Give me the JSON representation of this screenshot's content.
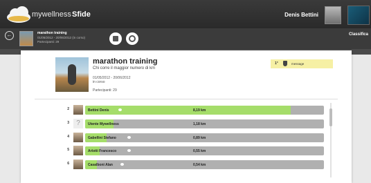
{
  "header": {
    "brand": "mywellness",
    "nav_tab": "Sfide",
    "user_name": "Denis Bettini"
  },
  "challenge_strip": {
    "title": "marathon training",
    "dates": "01/05/2012 - 20/06/2012 (in corso)",
    "participants": "Partecipanti: 29",
    "classifica_label": "Classifica"
  },
  "challenge": {
    "title": "marathon training",
    "subtitle": "Chi corre il maggior numero di km",
    "dates": "01/05/2012 - 20/06/2012",
    "status": "in corso",
    "participants": "Partecipanti: 29"
  },
  "my_rank": {
    "position": "1°",
    "message_label": "message"
  },
  "leaderboard": {
    "rows": [
      {
        "rank": "2",
        "name": "Bettini Denis",
        "distance": "8,19 km",
        "progress": 0.86,
        "has_photo": true
      },
      {
        "rank": "3",
        "name": "Utente Mywellness",
        "distance": "1,18 km",
        "progress": 0.12,
        "has_photo": false
      },
      {
        "rank": "4",
        "name": "Gabellini Stefano",
        "distance": "0,89 km",
        "progress": 0.09,
        "has_photo": true
      },
      {
        "rank": "5",
        "name": "Arlotti Francesco",
        "distance": "0,55 km",
        "progress": 0.06,
        "has_photo": true
      },
      {
        "rank": "6",
        "name": "Casalboni Alan",
        "distance": "0,54 km",
        "progress": 0.05,
        "has_photo": true
      }
    ]
  },
  "colors": {
    "progress_fill": "#a5dd6a",
    "bar_track": "#b0b0b0",
    "rank_highlight": "#f6f0a4",
    "topbar": "#2f2f2f"
  },
  "icons": [
    "cloud-logo-icon",
    "back-arrow-icon",
    "stop-icon",
    "refresh-icon",
    "trophy-icon",
    "chat-bubble-icon"
  ]
}
